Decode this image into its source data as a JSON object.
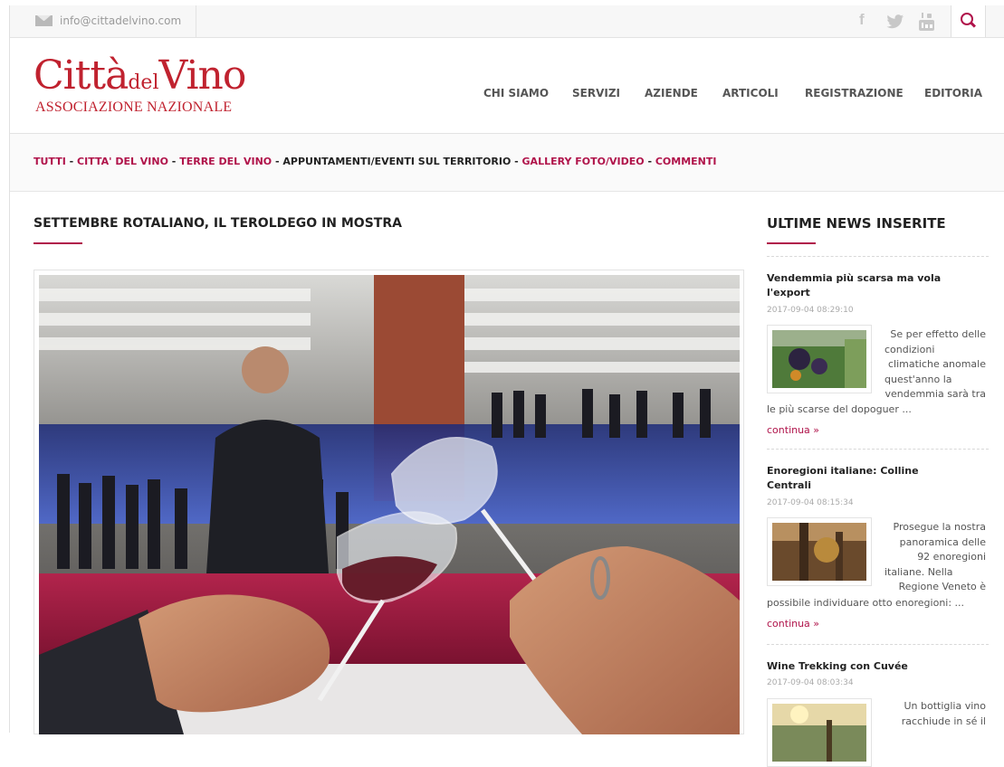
{
  "topbar": {
    "email": "info@cittadelvino.com",
    "social_icons": [
      "facebook-icon",
      "twitter-icon",
      "youtube-icon"
    ],
    "search_icon": "search-icon"
  },
  "logo": {
    "line1a": "Città",
    "line1b": "del",
    "line1c": "Vino",
    "line2": "ASSOCIAZIONE NAZIONALE"
  },
  "nav": [
    "CHI SIAMO",
    "SERVIZI",
    "AZIENDE",
    "ARTICOLI",
    "REGISTRAZIONE",
    "EDITORIA"
  ],
  "filters": {
    "items": [
      "TUTTI",
      "CITTA' DEL VINO",
      "TERRE DEL VINO",
      "APPUNTAMENTI/EVENTI SUL TERRITORIO",
      "GALLERY FOTO/VIDEO",
      "COMMENTI"
    ],
    "separator": " - ",
    "active_index": 3
  },
  "article": {
    "title": "SETTEMBRE ROTALIANO, IL TEROLDEGO IN MOSTRA"
  },
  "sidebar": {
    "title": "ULTIME NEWS INSERITE",
    "news": [
      {
        "title_l1": "Vendemmia più scarsa ma vola",
        "title_l2": "l'export",
        "date": "2017-09-04 08:29:10",
        "text_lines": [
          "Se per effetto delle",
          "condizioni",
          "climatiche anomale",
          "quest'anno la",
          "vendemmia sarà tra"
        ],
        "text_tail": "le più scarse del dopoguer ...",
        "more": "continua »"
      },
      {
        "title_l1": "Enoregioni italiane: Colline",
        "title_l2": "Centrali",
        "date": "2017-09-04 08:15:34",
        "text_lines": [
          "Prosegue la nostra",
          "panoramica delle",
          "92 enoregioni",
          "italiane. Nella",
          "Regione Veneto è"
        ],
        "text_tail": "possibile individuare otto enoregioni: ...",
        "more": "continua »"
      },
      {
        "title_l1": "Wine Trekking con Cuvée",
        "title_l2": "",
        "date": "2017-09-04 08:03:34",
        "text_lines": [
          "Un bottiglia vino",
          "racchiude in sé il"
        ],
        "text_tail": "",
        "more": ""
      }
    ]
  },
  "colors": {
    "accent": "#b0134a",
    "logo_red": "#c0222f",
    "topbar_bg": "#f7f7f7"
  }
}
